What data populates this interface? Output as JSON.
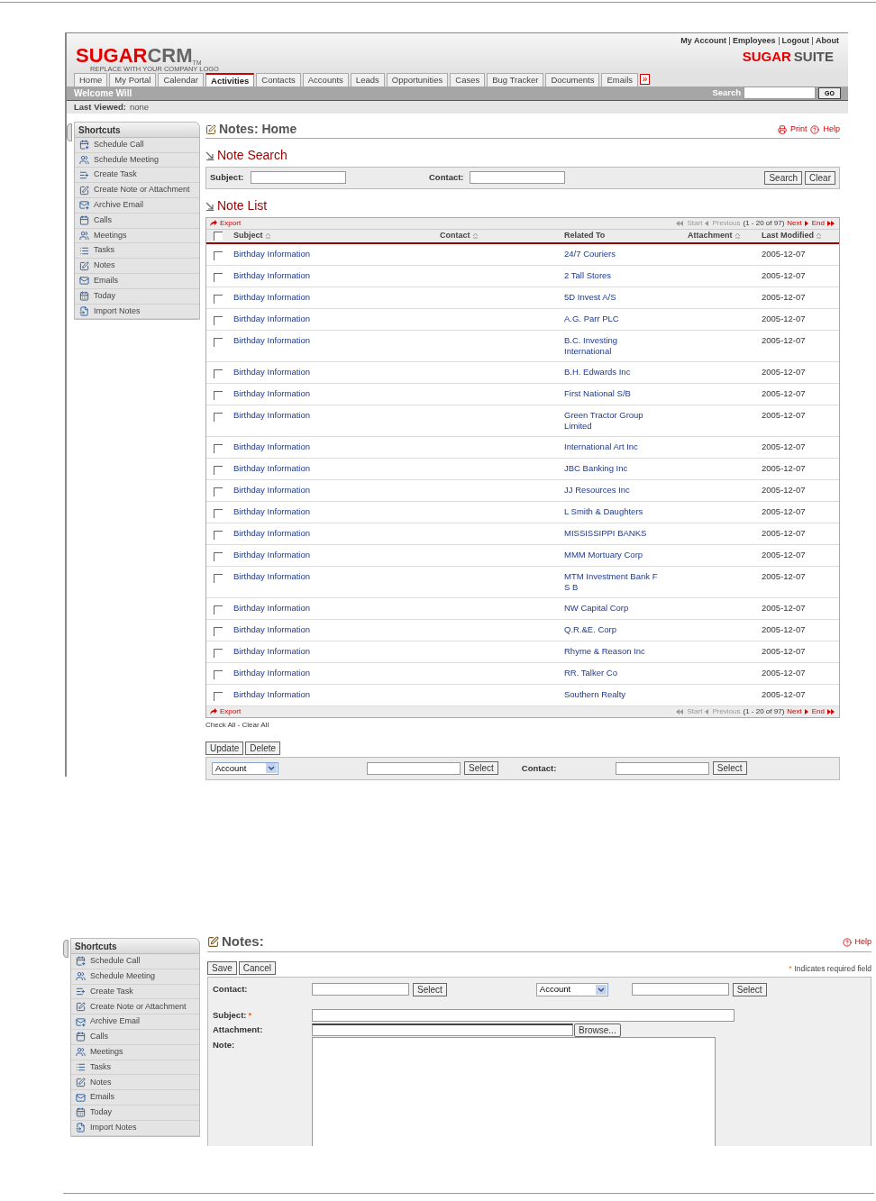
{
  "screen1": {
    "header_links": [
      "My Account",
      "Employees",
      "Logout",
      "About"
    ],
    "logo": {
      "part_1": "SUGAR",
      "part_2": "CRM",
      "mark": "TM",
      "tagline": "REPLACE WITH YOUR COMPANY LOGO"
    },
    "suite_logo": {
      "part_1": "SUGAR",
      "part_2": "SUITE"
    },
    "tabs": [
      {
        "label": "Home",
        "selected": false
      },
      {
        "label": "My Portal",
        "selected": false
      },
      {
        "label": "Calendar",
        "selected": false
      },
      {
        "label": "Activities",
        "selected": true
      },
      {
        "label": "Contacts",
        "selected": false
      },
      {
        "label": "Accounts",
        "selected": false
      },
      {
        "label": "Leads",
        "selected": false
      },
      {
        "label": "Opportunities",
        "selected": false
      },
      {
        "label": "Cases",
        "selected": false
      },
      {
        "label": "Bug Tracker",
        "selected": false
      },
      {
        "label": "Documents",
        "selected": false
      },
      {
        "label": "Emails",
        "selected": false
      }
    ],
    "more_tabs": "»",
    "welcome": "Welcome Will",
    "search": {
      "label": "Search",
      "button": "GO"
    },
    "last_viewed": {
      "label": "Last Viewed:",
      "value": "none"
    },
    "shortcuts": {
      "title": "Shortcuts",
      "items": [
        "Schedule Call",
        "Schedule Meeting",
        "Create Task",
        "Create Note or Attachment",
        "Archive Email",
        "Calls",
        "Meetings",
        "Tasks",
        "Notes",
        "Emails",
        "Today",
        "Import Notes"
      ]
    },
    "page_title": "Notes: Home",
    "actions": [
      "Print",
      "Help"
    ],
    "note_search": {
      "title": "Note Search",
      "fields": [
        "Subject:",
        "Contact:"
      ],
      "buttons": [
        "Search",
        "Clear"
      ]
    },
    "note_list": {
      "title": "Note List",
      "top_bar": {
        "export": "Export",
        "pager": {
          "start": "Start",
          "previous": "Previous",
          "range": "(1 - 20 of 97)",
          "next": "Next",
          "end": "End"
        }
      },
      "bottom_bar": {
        "export": "Export",
        "pager": {
          "start": "Start",
          "previous": "Previous",
          "range": "(1 - 20 of 97)",
          "next": "Next",
          "end": "End"
        }
      },
      "select_all_checked": false,
      "columns": [
        {
          "label": "Subject",
          "sortable": true
        },
        {
          "label": "Contact",
          "sortable": true
        },
        {
          "label": "Related To",
          "sortable": false
        },
        {
          "label": "Attachment",
          "sortable": true
        },
        {
          "label": "Last Modified",
          "sortable": true
        }
      ],
      "rows": [
        {
          "subject": "Birthday Information",
          "related_to": "24/7 Couriers",
          "last_modified": "2005-12-07",
          "checked": false
        },
        {
          "subject": "Birthday Information",
          "related_to": "2 Tall Stores",
          "last_modified": "2005-12-07",
          "checked": false
        },
        {
          "subject": "Birthday Information",
          "related_to": "5D Invest A/S",
          "last_modified": "2005-12-07",
          "checked": false
        },
        {
          "subject": "Birthday Information",
          "related_to": "A.G. Parr PLC",
          "last_modified": "2005-12-07",
          "checked": false
        },
        {
          "subject": "Birthday Information",
          "related_to": "B.C. Investing International",
          "last_modified": "2005-12-07",
          "checked": false
        },
        {
          "subject": "Birthday Information",
          "related_to": "B.H. Edwards Inc",
          "last_modified": "2005-12-07",
          "checked": false
        },
        {
          "subject": "Birthday Information",
          "related_to": "First National S/B",
          "last_modified": "2005-12-07",
          "checked": false
        },
        {
          "subject": "Birthday Information",
          "related_to": "Green Tractor Group Limited",
          "last_modified": "2005-12-07",
          "checked": false
        },
        {
          "subject": "Birthday Information",
          "related_to": "International Art Inc",
          "last_modified": "2005-12-07",
          "checked": false
        },
        {
          "subject": "Birthday Information",
          "related_to": "JBC Banking Inc",
          "last_modified": "2005-12-07",
          "checked": false
        },
        {
          "subject": "Birthday Information",
          "related_to": "JJ Resources Inc",
          "last_modified": "2005-12-07",
          "checked": false
        },
        {
          "subject": "Birthday Information",
          "related_to": "L Smith & Daughters",
          "last_modified": "2005-12-07",
          "checked": false
        },
        {
          "subject": "Birthday Information",
          "related_to": "MISSISSIPPI BANKS",
          "last_modified": "2005-12-07",
          "checked": false
        },
        {
          "subject": "Birthday Information",
          "related_to": "MMM Mortuary Corp",
          "last_modified": "2005-12-07",
          "checked": false
        },
        {
          "subject": "Birthday Information",
          "related_to": "MTM Investment Bank F S B",
          "last_modified": "2005-12-07",
          "checked": false
        },
        {
          "subject": "Birthday Information",
          "related_to": "NW Capital Corp",
          "last_modified": "2005-12-07",
          "checked": false
        },
        {
          "subject": "Birthday Information",
          "related_to": "Q.R.&E. Corp",
          "last_modified": "2005-12-07",
          "checked": false
        },
        {
          "subject": "Birthday Information",
          "related_to": "Rhyme & Reason Inc",
          "last_modified": "2005-12-07",
          "checked": false
        },
        {
          "subject": "Birthday Information",
          "related_to": "RR. Talker Co",
          "last_modified": "2005-12-07",
          "checked": false
        },
        {
          "subject": "Birthday Information",
          "related_to": "Southern Realty",
          "last_modified": "2005-12-07",
          "checked": false
        }
      ],
      "mass_select": "Check All - Clear All"
    },
    "buttons": [
      "Update",
      "Delete"
    ],
    "mass_update": {
      "type_select": "Account",
      "select_button": "Select",
      "contact_label": "Contact:",
      "contact_button": "Select"
    }
  },
  "screen2": {
    "shortcuts": {
      "title": "Shortcuts",
      "items": [
        "Schedule Call",
        "Schedule Meeting",
        "Create Task",
        "Create Note or Attachment",
        "Archive Email",
        "Calls",
        "Meetings",
        "Tasks",
        "Notes",
        "Emails",
        "Today",
        "Import Notes"
      ]
    },
    "page_title": "Notes:",
    "help": "Help",
    "buttons": [
      "Save",
      "Cancel"
    ],
    "required_note": {
      "mark": "*",
      "text": "Indicates required field"
    },
    "form": {
      "contact_label": "Contact:",
      "contact_button": "Select",
      "parent_select": "Account",
      "parent_button": "Select",
      "subject_label": "Subject:",
      "required_mark": "*",
      "attachment_label": "Attachment:",
      "browse_button": "Browse...",
      "note_label": "Note:"
    }
  }
}
